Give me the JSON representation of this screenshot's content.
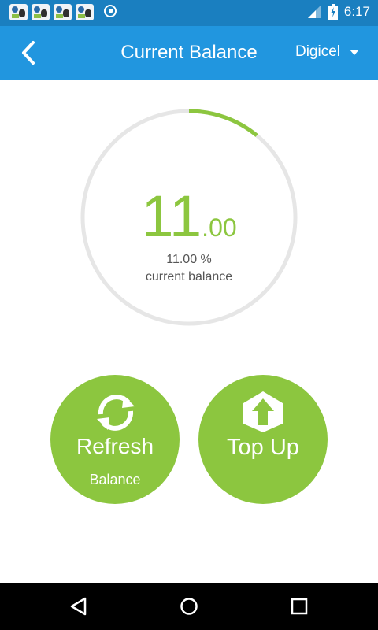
{
  "status_bar": {
    "time": "6:17",
    "notification_icons": [
      "app-icon",
      "app-icon",
      "app-icon",
      "app-icon",
      "vpn-key-icon"
    ]
  },
  "app_bar": {
    "title": "Current Balance",
    "carrier": "Digicel"
  },
  "balance": {
    "integer": "11",
    "decimal": ".00",
    "percent_text": "11.00 %",
    "label": "current balance",
    "progress_fraction": 0.11
  },
  "actions": {
    "refresh_label": "Refresh",
    "refresh_sub": "Balance",
    "topup_label": "Top Up"
  },
  "colors": {
    "status_bar": "#1a7fc0",
    "app_bar": "#2196df",
    "accent_green": "#8cc63f",
    "track_gray": "#e6e6e6"
  }
}
